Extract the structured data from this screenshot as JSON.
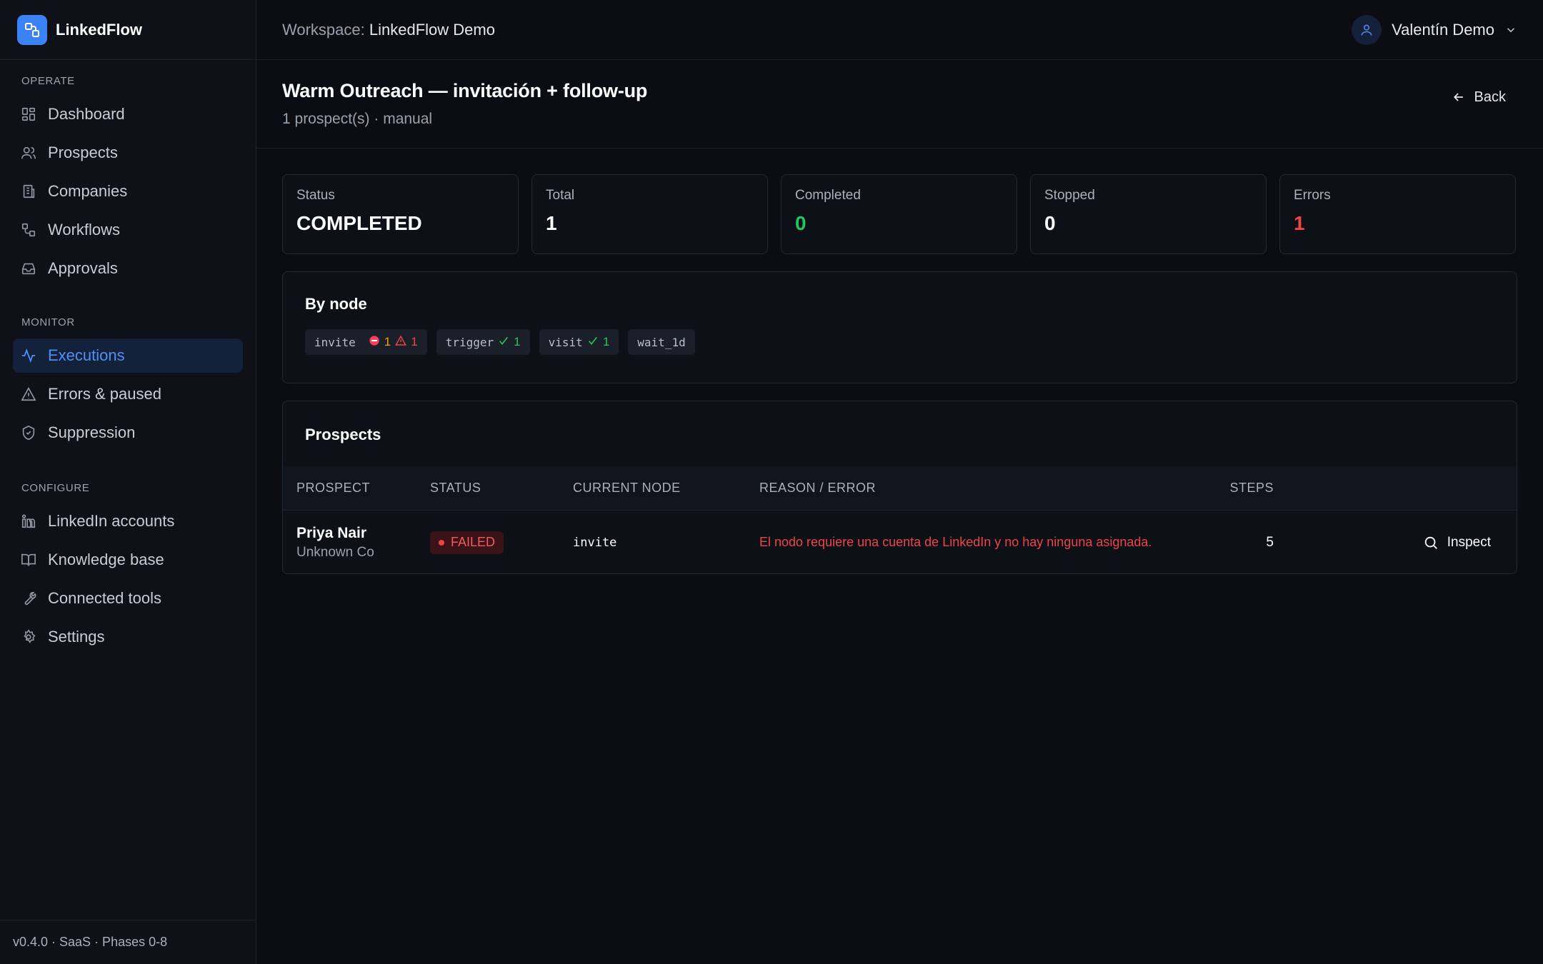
{
  "brand": {
    "name": "LinkedFlow",
    "accent": "#3b82f6"
  },
  "sidebar": {
    "sections": {
      "operate": "OPERATE",
      "monitor": "MONITOR",
      "configure": "CONFIGURE"
    },
    "items": [
      {
        "label": "Dashboard",
        "icon": "dashboard-icon"
      },
      {
        "label": "Prospects",
        "icon": "users-icon"
      },
      {
        "label": "Companies",
        "icon": "building-icon"
      },
      {
        "label": "Workflows",
        "icon": "workflow-icon"
      },
      {
        "label": "Approvals",
        "icon": "inbox-icon"
      },
      {
        "label": "Executions",
        "icon": "activity-icon",
        "active": true
      },
      {
        "label": "Errors & paused",
        "icon": "warning-icon"
      },
      {
        "label": "Suppression",
        "icon": "shield-icon"
      },
      {
        "label": "LinkedIn accounts",
        "icon": "linkedin-icon"
      },
      {
        "label": "Knowledge base",
        "icon": "book-icon"
      },
      {
        "label": "Connected tools",
        "icon": "wrench-icon"
      },
      {
        "label": "Settings",
        "icon": "gear-icon"
      }
    ],
    "footer": "v0.4.0 · SaaS · Phases 0-8"
  },
  "topbar": {
    "workspace_label": "Workspace:",
    "workspace_name": "LinkedFlow Demo",
    "user_name": "Valentín Demo"
  },
  "page": {
    "title": "Warm Outreach — invitación + follow-up",
    "subtitle": "1 prospect(s) · manual",
    "back_label": "Back"
  },
  "stats": [
    {
      "label": "Status",
      "value": "COMPLETED"
    },
    {
      "label": "Total",
      "value": "1"
    },
    {
      "label": "Completed",
      "value": "0"
    },
    {
      "label": "Stopped",
      "value": "0"
    },
    {
      "label": "Errors",
      "value": "1"
    }
  ],
  "by_node": {
    "title": "By node",
    "chips": [
      {
        "node": "invite",
        "stopped": "1",
        "errors": "1"
      },
      {
        "node": "trigger",
        "ok": "1"
      },
      {
        "node": "visit",
        "ok": "1"
      },
      {
        "node": "wait_1d"
      }
    ]
  },
  "prospects": {
    "title": "Prospects",
    "columns": [
      "PROSPECT",
      "STATUS",
      "CURRENT NODE",
      "REASON / ERROR",
      "STEPS"
    ],
    "rows": [
      {
        "name": "Priya Nair",
        "company": "Unknown Co",
        "status": "FAILED",
        "current_node": "invite",
        "reason": "El nodo requiere una cuenta de LinkedIn y no hay ninguna asignada.",
        "steps": "5",
        "action": "Inspect"
      }
    ]
  },
  "colors": {
    "success": "#22c55e",
    "error": "#ef4444",
    "warning": "#f59e0b",
    "active_nav": "#4f8ff7"
  }
}
